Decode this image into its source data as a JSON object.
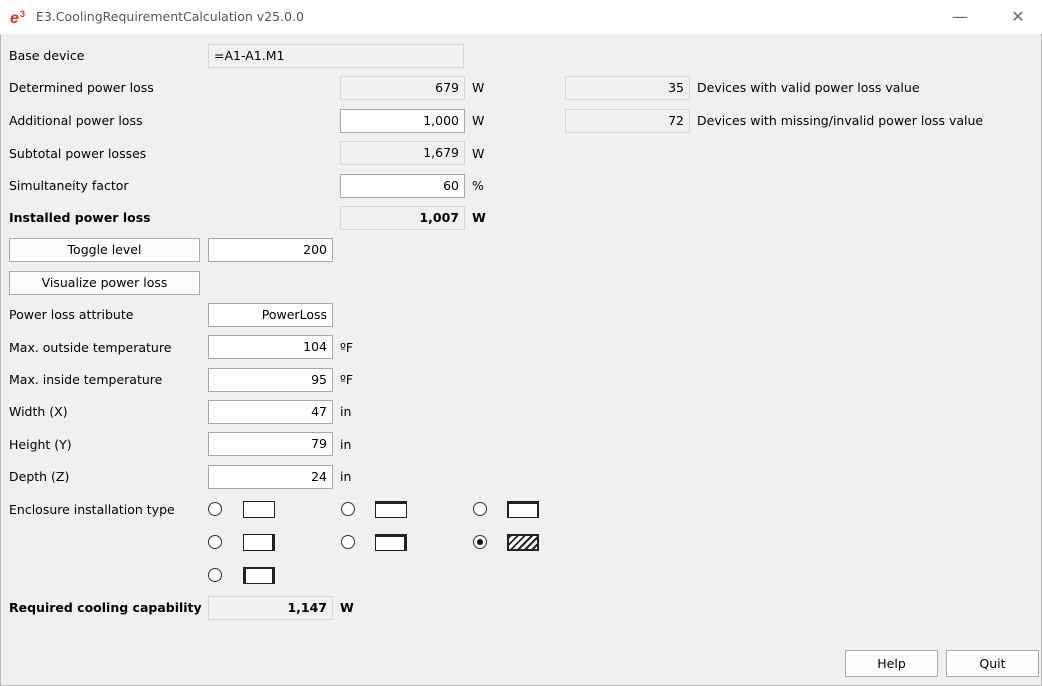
{
  "window": {
    "title": "E3.CoolingRequirementCalculation v25.0.0",
    "minimize_icon": "minimize-icon",
    "close_icon": "close-icon",
    "app_icon": "e3-logo-icon",
    "accent_color": "#d0312d"
  },
  "form": {
    "base_device": {
      "label": "Base device",
      "value": "=A1-A1.M1"
    },
    "determined_power_loss": {
      "label": "Determined power loss",
      "value": "679",
      "unit": "W"
    },
    "additional_power_loss": {
      "label": "Additional power loss",
      "value": "1,000",
      "unit": "W"
    },
    "subtotal_power_losses": {
      "label": "Subtotal power losses",
      "value": "1,679",
      "unit": "W"
    },
    "simultaneity_factor": {
      "label": "Simultaneity factor",
      "value": "60",
      "unit": "%"
    },
    "installed_power_loss": {
      "label": "Installed power loss",
      "value": "1,007",
      "unit": "W"
    },
    "valid_devices": {
      "value": "35",
      "label": "Devices with valid power loss value"
    },
    "invalid_devices": {
      "value": "72",
      "label": "Devices with missing/invalid power loss value"
    },
    "toggle_level": {
      "button": "Toggle level",
      "value": "200"
    },
    "visualize_button": "Visualize power loss",
    "power_loss_attribute": {
      "label": "Power loss attribute",
      "value": "PowerLoss"
    },
    "max_outside_temp": {
      "label": "Max. outside temperature",
      "value": "104",
      "unit": "ºF"
    },
    "max_inside_temp": {
      "label": "Max. inside temperature",
      "value": "95",
      "unit": "ºF"
    },
    "width": {
      "label": "Width (X)",
      "value": "47",
      "unit": "in"
    },
    "height": {
      "label": "Height (Y)",
      "value": "79",
      "unit": "in"
    },
    "depth": {
      "label": "Depth (Z)",
      "value": "24",
      "unit": "in"
    },
    "enclosure_installation_type": {
      "label": "Enclosure installation type",
      "options": [
        {
          "id": "1",
          "checked": false
        },
        {
          "id": "2",
          "checked": false
        },
        {
          "id": "3",
          "checked": false
        },
        {
          "id": "4",
          "checked": false
        },
        {
          "id": "5",
          "checked": false
        },
        {
          "id": "6",
          "checked": true
        },
        {
          "id": "7",
          "checked": false
        }
      ]
    },
    "required_cooling": {
      "label": "Required cooling capability",
      "value": "1,147",
      "unit": "W"
    }
  },
  "footer": {
    "help": "Help",
    "quit": "Quit"
  }
}
